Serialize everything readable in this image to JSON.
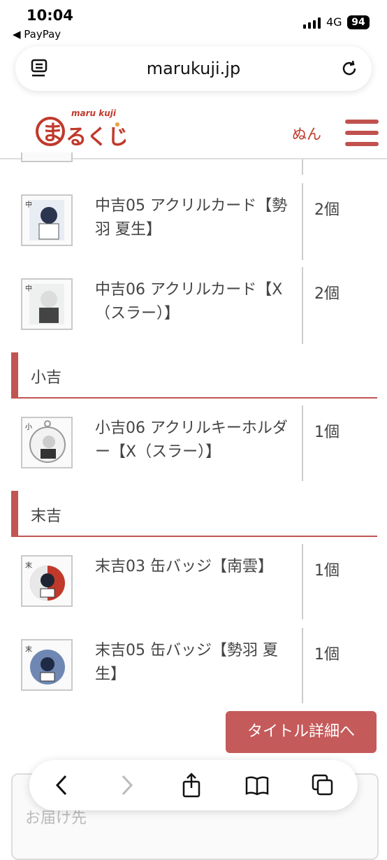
{
  "status_bar": {
    "time": "10:04",
    "back_app": "◀ PayPay",
    "network": "4G",
    "battery": "94"
  },
  "browser": {
    "url": "marukuji.jp"
  },
  "site": {
    "logo_text": "まるくじ",
    "logo_sub": "maru kuji",
    "username": "ぬん"
  },
  "sections": [
    {
      "items": [
        {
          "name": "中吉05 アクリルカード【勢羽 夏生】",
          "qty": "2個"
        },
        {
          "name": "中吉06 アクリルカード【X（スラー）】",
          "qty": "2個"
        }
      ]
    },
    {
      "title": "小吉",
      "items": [
        {
          "name": "小吉06 アクリルキーホルダー【X（スラー）】",
          "qty": "1個"
        }
      ]
    },
    {
      "title": "末吉",
      "items": [
        {
          "name": "末吉03 缶バッジ【南雲】",
          "qty": "1個"
        },
        {
          "name": "末吉05 缶バッジ【勢羽 夏生】",
          "qty": "1個"
        }
      ]
    }
  ],
  "detail_button": "タイトル詳細へ",
  "bottom_card_label": "お届け先",
  "colors": {
    "accent": "#c05552",
    "button": "#c55a5a"
  }
}
